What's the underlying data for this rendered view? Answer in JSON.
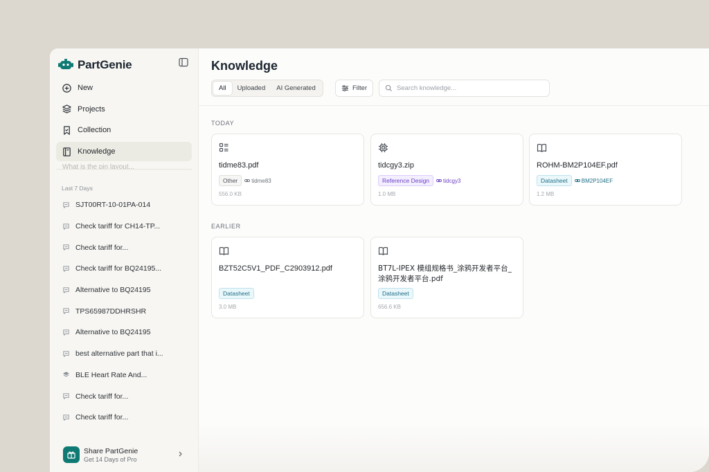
{
  "brand": {
    "name": "PartGenie"
  },
  "nav": [
    {
      "label": "New",
      "icon": "plus-circle-icon"
    },
    {
      "label": "Projects",
      "icon": "layers-icon"
    },
    {
      "label": "Collection",
      "icon": "bookmark-icon"
    },
    {
      "label": "Knowledge",
      "icon": "book-icon"
    }
  ],
  "ghost_item": "What is the pin layout...",
  "history": {
    "section_label": "Last 7 Days",
    "items": [
      "SJT00RT-10-01PA-014",
      "Check tariff for CH14-TP...",
      "Check tariff for...",
      "Check tariff for BQ24195...",
      "Alternative to BQ24195",
      "TPS65987DDHRSHR",
      "Alternative to BQ24195",
      "best alternative part that i...",
      "BLE Heart Rate And...",
      "Check tariff for...",
      "Check tariff for..."
    ]
  },
  "share": {
    "title": "Share PartGenie",
    "subtitle": "Get 14 Days of Pro"
  },
  "main": {
    "title": "Knowledge",
    "tabs": [
      "All",
      "Uploaded",
      "AI Generated"
    ],
    "filter_label": "Filter",
    "search_placeholder": "Search knowledge..."
  },
  "groups": {
    "today_label": "TODAY",
    "earlier_label": "EARLIER"
  },
  "cards": {
    "c1": {
      "name": "tidme83.pdf",
      "tag": "Other",
      "link": "tidme83",
      "size": "556.0 KB",
      "icon": "list-icon"
    },
    "c2": {
      "name": "tidcgy3.zip",
      "tag": "Reference Design",
      "link": "tidcgy3",
      "size": "1.0 MB",
      "icon": "chip-icon"
    },
    "c3": {
      "name": "ROHM-BM2P104EF.pdf",
      "tag": "Datasheet",
      "link": "BM2P104EF",
      "size": "1.2 MB",
      "icon": "book-open-icon"
    },
    "c4": {
      "name": "BZT52C5V1_PDF_C2903912.pdf",
      "tag": "Datasheet",
      "size": "3.0 MB",
      "icon": "book-open-icon"
    },
    "c5": {
      "name": "BT7L-IPEX 模组规格书_涂鸦开发者平台_涂鸦开发者平台.pdf",
      "tag": "Datasheet",
      "size": "656.6 KB",
      "icon": "book-open-icon"
    }
  },
  "colors": {
    "accent_teal": "#0f7a73",
    "active_nav": "#ecebe3",
    "purple_tag": "#6b3fc4",
    "datasheet_tag": "#1f6f86"
  }
}
